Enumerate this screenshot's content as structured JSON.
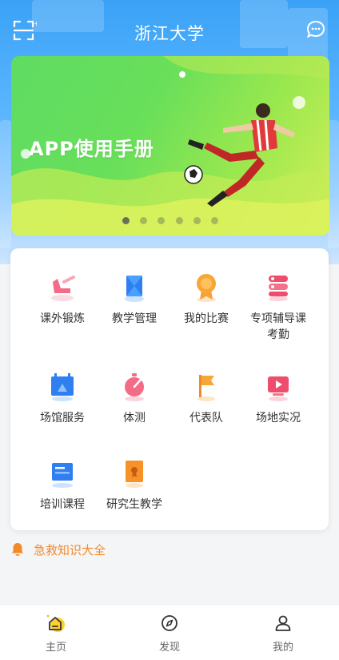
{
  "header": {
    "title": "浙江大学"
  },
  "banner": {
    "title": "APP使用手册",
    "dot_count": 6,
    "active_dot": 0
  },
  "menu": {
    "items": [
      {
        "label": "课外锻炼",
        "icon": "training-icon"
      },
      {
        "label": "教学管理",
        "icon": "teaching-icon"
      },
      {
        "label": "我的比赛",
        "icon": "medal-icon"
      },
      {
        "label": "专项辅导课\n考勤",
        "icon": "attendance-icon"
      },
      {
        "label": "场馆服务",
        "icon": "venue-icon"
      },
      {
        "label": "体测",
        "icon": "fitness-test-icon"
      },
      {
        "label": "代表队",
        "icon": "flag-icon"
      },
      {
        "label": "场地实况",
        "icon": "video-icon"
      },
      {
        "label": "培训课程",
        "icon": "course-icon"
      },
      {
        "label": "研究生教学",
        "icon": "graduate-icon"
      }
    ]
  },
  "first_aid": {
    "label": "急救知识大全"
  },
  "tabbar": {
    "items": [
      {
        "label": "主页",
        "icon": "home-icon"
      },
      {
        "label": "发现",
        "icon": "compass-icon"
      },
      {
        "label": "我的",
        "icon": "profile-icon"
      }
    ]
  },
  "colors": {
    "accent_orange": "#f28a2a",
    "hero_blue": "#4aa8f8",
    "banner_green": "#69df5a"
  }
}
